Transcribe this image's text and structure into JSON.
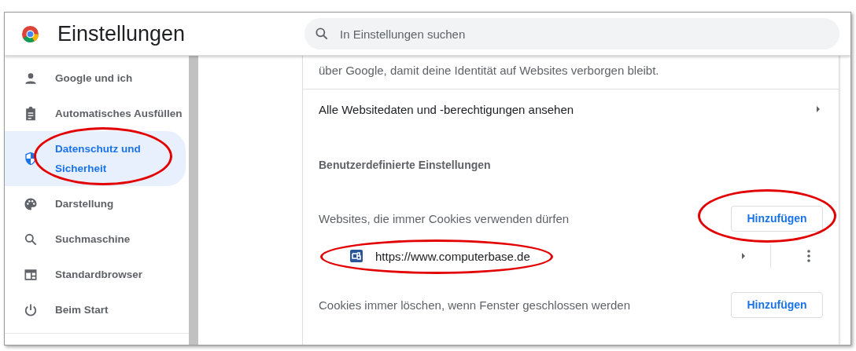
{
  "header": {
    "title": "Einstellungen",
    "search": {
      "placeholder": "In Einstellungen suchen"
    }
  },
  "sidebar": {
    "items": [
      {
        "label": "Google und ich",
        "kind": "person",
        "selected": false,
        "circled": false
      },
      {
        "label": "Automatisches Ausfüllen",
        "kind": "clipboard",
        "selected": false,
        "circled": false
      },
      {
        "label": "Datenschutz und Sicherheit",
        "kind": "shield",
        "selected": true,
        "circled": true
      },
      {
        "label": "Darstellung",
        "kind": "palette",
        "selected": false,
        "circled": false
      },
      {
        "label": "Suchmaschine",
        "kind": "search",
        "selected": false,
        "circled": false
      },
      {
        "label": "Standardbrowser",
        "kind": "browser",
        "selected": false,
        "circled": false
      },
      {
        "label": "Beim Start",
        "kind": "power",
        "selected": false,
        "circled": false
      }
    ]
  },
  "content": {
    "description": "über Google, damit deine Identität auf Websites verborgen bleibt.",
    "all_data_link": "Alle Websitedaten und -berechtigungen ansehen",
    "section_heading": "Benutzerdefinierte Einstellungen",
    "groups": [
      {
        "label": "Websites, die immer Cookies verwenden dürfen",
        "button": "Hinzufügen",
        "button_circled": true,
        "sites": [
          {
            "url": "https://www.computerbase.de",
            "circled": true
          }
        ]
      },
      {
        "label": "Cookies immer löschen, wenn Fenster geschlossen werden",
        "button": "Hinzufügen",
        "button_circled": false
      }
    ]
  }
}
